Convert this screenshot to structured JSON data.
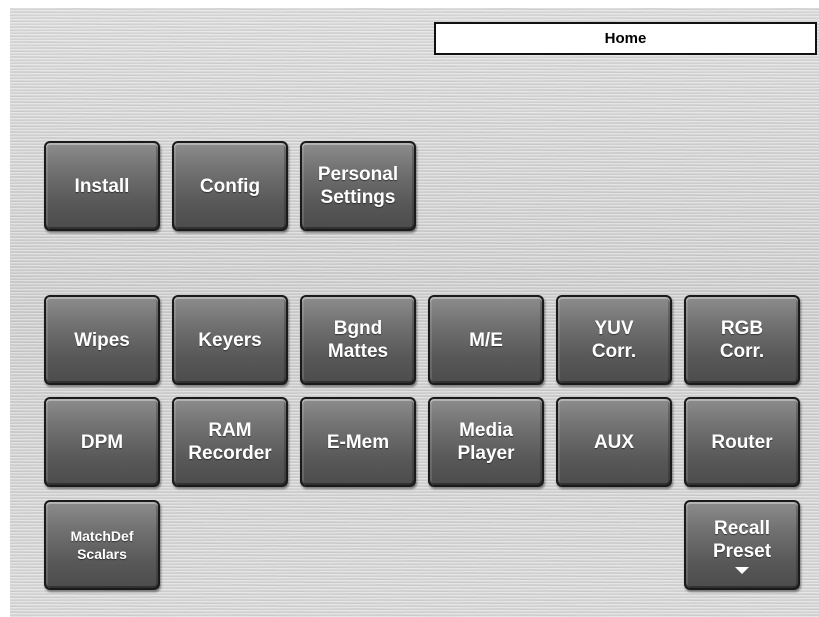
{
  "header": {
    "title": "Home"
  },
  "row1": {
    "install": {
      "label": "Install"
    },
    "config": {
      "label": "Config"
    },
    "personal_settings": {
      "line1": "Personal",
      "line2": "Settings"
    }
  },
  "row2": {
    "wipes": {
      "label": "Wipes"
    },
    "keyers": {
      "label": "Keyers"
    },
    "bgnd_mattes": {
      "line1": "Bgnd",
      "line2": "Mattes"
    },
    "me": {
      "label": "M/E"
    },
    "yuv_corr": {
      "line1": "YUV",
      "line2": "Corr."
    },
    "rgb_corr": {
      "line1": "RGB",
      "line2": "Corr."
    }
  },
  "row3": {
    "dpm": {
      "label": "DPM"
    },
    "ram_recorder": {
      "line1": "RAM",
      "line2": "Recorder"
    },
    "e_mem": {
      "label": "E-Mem"
    },
    "media_player": {
      "line1": "Media",
      "line2": "Player"
    },
    "aux": {
      "label": "AUX"
    },
    "router": {
      "label": "Router"
    }
  },
  "row4": {
    "matchdef_scalars": {
      "line1": "MatchDef",
      "line2": "Scalars"
    },
    "recall_preset": {
      "line1": "Recall",
      "line2": "Preset",
      "icon": "dropdown-arrow-icon"
    }
  },
  "colors": {
    "panel": "#d6d6d6",
    "button": "#6f6f6f",
    "button_text": "#ffffff",
    "title_bg": "#ffffff",
    "border": "#111111"
  }
}
